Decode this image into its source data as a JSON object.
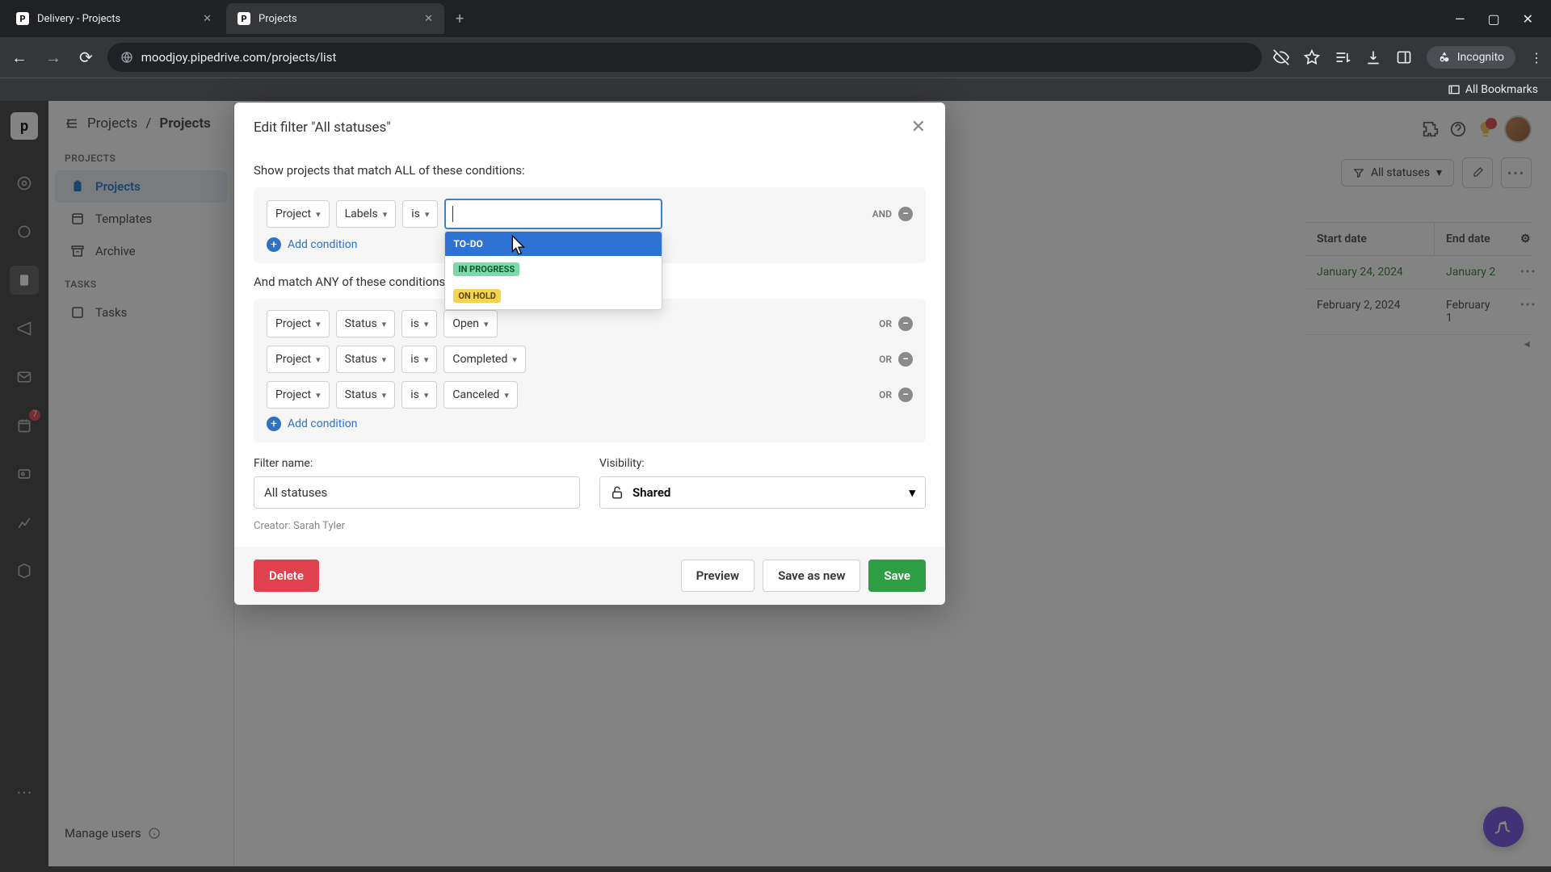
{
  "browser": {
    "tabs": [
      {
        "title": "Delivery - Projects",
        "favicon": "P"
      },
      {
        "title": "Projects",
        "favicon": "P"
      }
    ],
    "url": "moodjoy.pipedrive.com/projects/list",
    "incognito_label": "Incognito",
    "bookmarks_label": "All Bookmarks"
  },
  "rail": {
    "logo": "p",
    "badge_count": "7"
  },
  "sidebar": {
    "breadcrumb_root": "Projects",
    "breadcrumb_leaf": "Projects",
    "sections": {
      "projects_heading": "PROJECTS",
      "projects_items": [
        "Projects",
        "Templates",
        "Archive"
      ],
      "tasks_heading": "TASKS",
      "tasks_items": [
        "Tasks"
      ]
    },
    "manage_users": "Manage users"
  },
  "toolbar": {
    "filter_label": "All statuses"
  },
  "table": {
    "headers": {
      "start": "Start date",
      "end": "End date"
    },
    "rows": [
      {
        "start": "January 24, 2024",
        "end": "January 2"
      },
      {
        "start": "February 2, 2024",
        "end": "February 1"
      }
    ]
  },
  "modal": {
    "title": "Edit filter \"All statuses\"",
    "all_label": "Show projects that match ALL of these conditions:",
    "any_label": "And match ANY of these conditions:",
    "and_label": "AND",
    "or_label": "OR",
    "add_condition": "Add condition",
    "conditions_all": [
      {
        "field": "Project",
        "attr": "Labels",
        "op": "is"
      }
    ],
    "dropdown_options": [
      {
        "text": "TO-DO",
        "style": "hover"
      },
      {
        "text": "IN PROGRESS",
        "style": "green"
      },
      {
        "text": "ON HOLD",
        "style": "yellow"
      }
    ],
    "conditions_any": [
      {
        "field": "Project",
        "attr": "Status",
        "op": "is",
        "value": "Open"
      },
      {
        "field": "Project",
        "attr": "Status",
        "op": "is",
        "value": "Completed"
      },
      {
        "field": "Project",
        "attr": "Status",
        "op": "is",
        "value": "Canceled"
      }
    ],
    "filter_name_label": "Filter name:",
    "filter_name_value": "All statuses",
    "visibility_label": "Visibility:",
    "visibility_value": "Shared",
    "creator_label": "Creator: Sarah Tyler",
    "buttons": {
      "delete": "Delete",
      "preview": "Preview",
      "save_as_new": "Save as new",
      "save": "Save"
    }
  }
}
